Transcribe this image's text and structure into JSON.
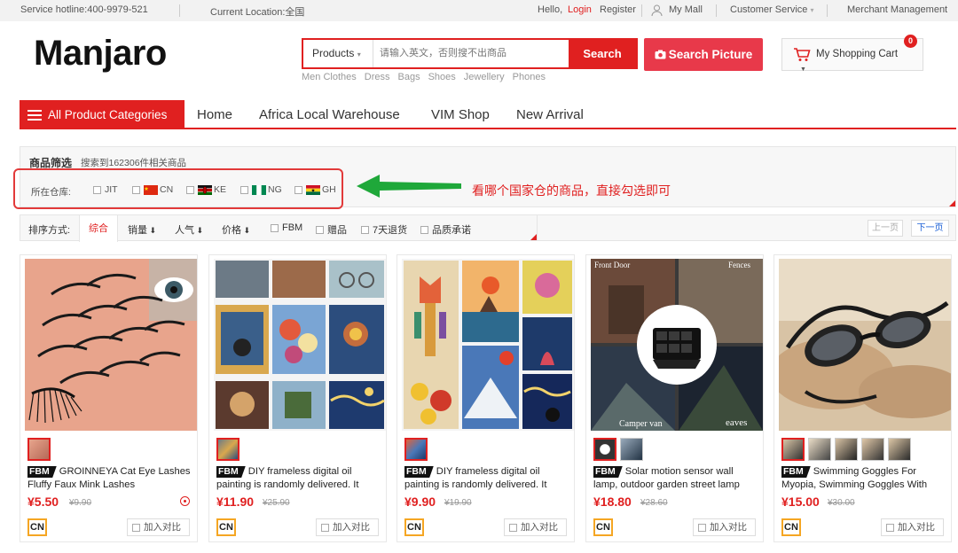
{
  "topbar": {
    "hotline": "Service hotline:400-9979-521",
    "location": "Current Location:全国",
    "hello": "Hello,",
    "login": "Login",
    "register": "Register",
    "my_mall": "My Mall",
    "customer_service": "Customer Service",
    "merchant": "Merchant Management"
  },
  "header": {
    "logo": "Manjaro",
    "search_category": "Products",
    "search_placeholder": "请输入英文，否则搜不出商品",
    "search_button": "Search",
    "picture_button": "Search Picture",
    "hot_words": [
      "Men Clothes",
      "Dress",
      "Bags",
      "Shoes",
      "Jewellery",
      "Phones"
    ],
    "cart_label": "My Shopping Cart",
    "cart_count": "0"
  },
  "nav": {
    "all_categories": "All Product Categories",
    "items": [
      "Home",
      "Africa Local Warehouse",
      "VIM Shop",
      "New Arrival"
    ]
  },
  "filter": {
    "title": "商品筛选",
    "result": "搜索到162306件相关商品",
    "warehouse_label": "所在仓库:",
    "warehouses": [
      "JIT",
      "CN",
      "KE",
      "NG",
      "GH"
    ],
    "annotation": "看哪个国家仓的商品，直接勾选即可"
  },
  "sort": {
    "label": "排序方式:",
    "options": [
      "综合",
      "销量",
      "人气",
      "价格"
    ],
    "checks": [
      "FBM",
      "赠品",
      "7天退货",
      "品质承诺"
    ],
    "prev": "上一页",
    "next": "下一页"
  },
  "products": [
    {
      "badge": "FBM",
      "title": "GROINNEYA Cat Eye Lashes Fluffy Faux Mink Lashes",
      "price": "¥5.50",
      "old_price": "¥9.90",
      "origin": "CN",
      "compare": "加入对比"
    },
    {
      "badge": "FBM",
      "title": "DIY frameless digital oil painting is randomly delivered. It",
      "price": "¥11.90",
      "old_price": "¥25.90",
      "origin": "CN",
      "compare": "加入对比"
    },
    {
      "badge": "FBM",
      "title": "DIY frameless digital oil painting is randomly delivered. It",
      "price": "¥9.90",
      "old_price": "¥19.90",
      "origin": "CN",
      "compare": "加入对比"
    },
    {
      "badge": "FBM",
      "title": "Solar motion sensor wall lamp, outdoor garden street lamp",
      "price": "¥18.80",
      "old_price": "¥28.60",
      "origin": "CN",
      "compare": "加入对比"
    },
    {
      "badge": "FBM",
      "title": "Swimming Goggles For Myopia, Swimming Goggles With",
      "price": "¥15.00",
      "old_price": "¥30.00",
      "origin": "CN",
      "compare": "加入对比"
    }
  ],
  "image_labels": {
    "front_door": "Front Door",
    "fences": "Fences",
    "camper_van": "Camper van",
    "eaves": "eaves"
  },
  "colors": {
    "accent": "#e02020",
    "annotation_arrow": "#1fa83a",
    "origin_border": "#f5a623"
  }
}
